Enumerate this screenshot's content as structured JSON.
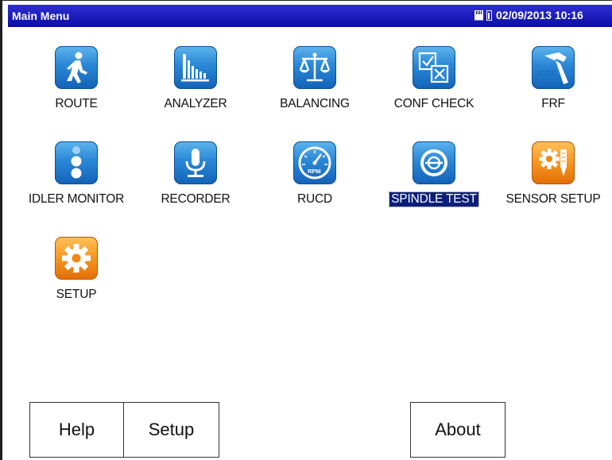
{
  "titlebar": {
    "title": "Main Menu",
    "datetime": "02/09/2013 10:16",
    "sd_icon": "sd-card-icon",
    "battery_icon": "battery-icon"
  },
  "menu": [
    {
      "label": "ROUTE",
      "icon": "walking-person-icon",
      "color": "blue"
    },
    {
      "label": "ANALYZER",
      "icon": "spectrum-bars-icon",
      "color": "blue"
    },
    {
      "label": "BALANCING",
      "icon": "balance-scale-icon",
      "color": "blue"
    },
    {
      "label": "CONF CHECK",
      "icon": "checkbox-icon",
      "color": "blue"
    },
    {
      "label": "FRF",
      "icon": "hammer-icon",
      "color": "blue",
      "icon_text": "FRF"
    },
    {
      "label": "IDLER MONITOR",
      "icon": "idler-rollers-icon",
      "color": "blue"
    },
    {
      "label": "RECORDER",
      "icon": "microphone-icon",
      "color": "blue"
    },
    {
      "label": "RUCD",
      "icon": "rpm-gauge-icon",
      "color": "blue",
      "icon_text": "RPM"
    },
    {
      "label": "SPINDLE TEST",
      "icon": "spindle-icon",
      "color": "blue",
      "selected": true
    },
    {
      "label": "SENSOR SETUP",
      "icon": "sensor-gear-icon",
      "color": "orange"
    },
    {
      "label": "SETUP",
      "icon": "gear-icon",
      "color": "orange"
    }
  ],
  "buttons": {
    "help": "Help",
    "setup": "Setup",
    "about": "About"
  },
  "colors": {
    "titlebar": "#1414b8",
    "icon_blue": "#2a87d6",
    "icon_orange": "#f79a22",
    "selection": "#0a1e7a"
  }
}
